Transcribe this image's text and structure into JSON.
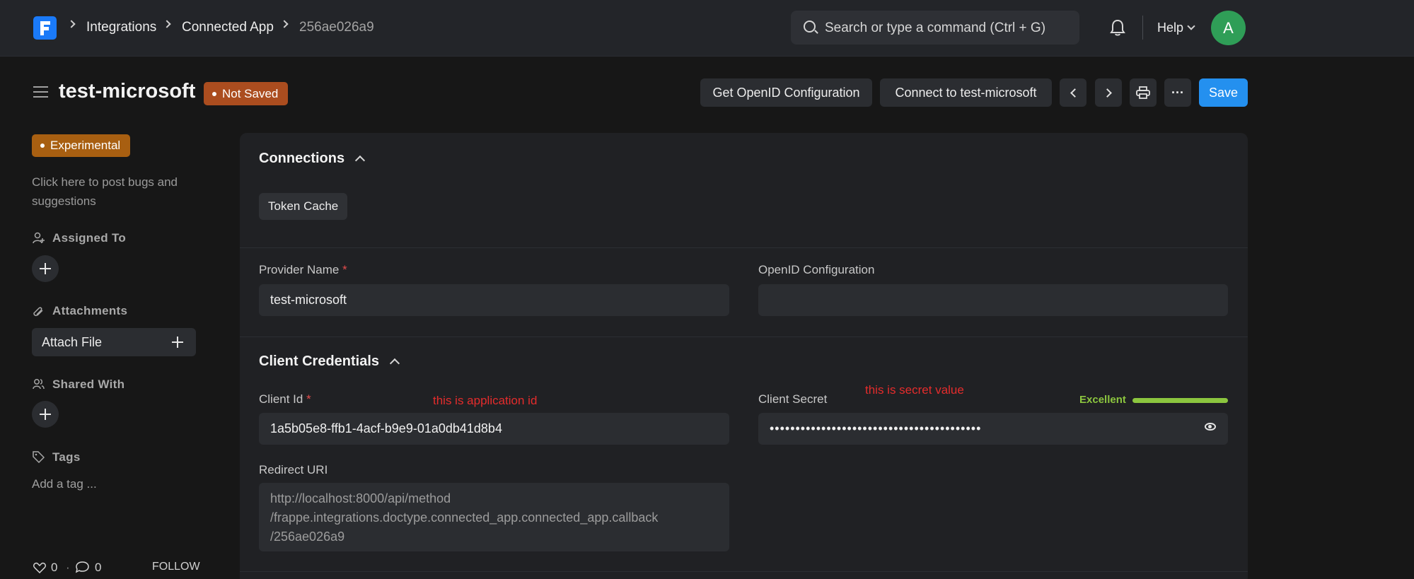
{
  "navbar": {
    "breadcrumbs": [
      "Integrations",
      "Connected App",
      "256ae026a9"
    ],
    "search_placeholder": "Search or type a command (Ctrl + G)",
    "help_label": "Help",
    "avatar_initial": "A"
  },
  "header": {
    "title": "test-microsoft",
    "status": "Not Saved",
    "buttons": {
      "openid": "Get OpenID Configuration",
      "connect": "Connect to test-microsoft",
      "more": "···",
      "save": "Save"
    }
  },
  "sidebar": {
    "badge": "Experimental",
    "bug_link_line1": "Click here to post bugs and",
    "bug_link_line2": "suggestions",
    "assigned_to": "Assigned To",
    "attachments": "Attachments",
    "attach_file": "Attach File",
    "shared_with": "Shared With",
    "tags": "Tags",
    "add_tag": "Add a tag ...",
    "likes": "0",
    "comments": "0",
    "follow": "FOLLOW"
  },
  "form": {
    "connections": {
      "title": "Connections",
      "token_cache": "Token Cache"
    },
    "provider_name": {
      "label": "Provider Name",
      "value": "test-microsoft"
    },
    "openid_configuration": {
      "label": "OpenID Configuration",
      "value": ""
    },
    "client_credentials": {
      "title": "Client Credentials",
      "client_id": {
        "label": "Client Id",
        "value": "1a5b05e8-ffb1-4acf-b9e9-01a0db41d8b4",
        "note": "this is application id"
      },
      "client_secret": {
        "label": "Client Secret",
        "value": "•••••••••••••••••••••••••••••••••••••••••",
        "note": "this is secret value",
        "strength": "Excellent"
      },
      "redirect_uri": {
        "label": "Redirect URI",
        "line1": "http://localhost:8000/api/method",
        "line2": "/frappe.integrations.doctype.connected_app.connected_app.callback",
        "line3": "/256ae026a9"
      }
    }
  }
}
